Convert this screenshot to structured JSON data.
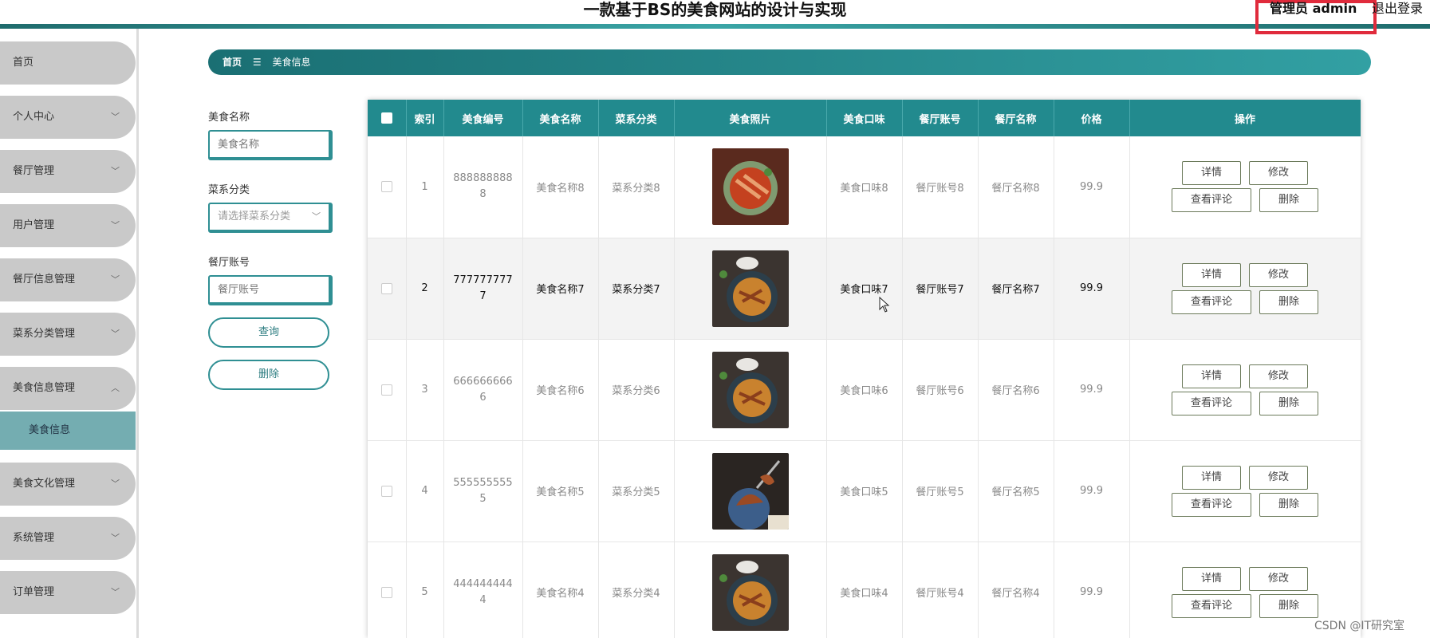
{
  "header": {
    "title": "一款基于BS的美食网站的设计与实现",
    "admin_label": "管理员 admin",
    "logout_label": "退出登录",
    "accent": "#e02b3c"
  },
  "sidebar": {
    "items": [
      {
        "label": "首页"
      },
      {
        "label": "个人中心"
      },
      {
        "label": "餐厅管理"
      },
      {
        "label": "用户管理"
      },
      {
        "label": "餐厅信息管理"
      },
      {
        "label": "菜系分类管理"
      },
      {
        "label": "美食信息管理"
      },
      {
        "label": "美食文化管理"
      },
      {
        "label": "系统管理"
      },
      {
        "label": "订单管理"
      }
    ],
    "sub_item": "美食信息"
  },
  "breadcrumb": {
    "home": "首页",
    "separator": "☰",
    "current": "美食信息"
  },
  "filters": {
    "name_label": "美食名称",
    "name_placeholder": "美食名称",
    "category_label": "菜系分类",
    "category_placeholder": "请选择菜系分类",
    "account_label": "餐厅账号",
    "account_placeholder": "餐厅账号",
    "query_button": "查询",
    "delete_button": "删除"
  },
  "table": {
    "headers": [
      "索引",
      "美食编号",
      "美食名称",
      "菜系分类",
      "美食照片",
      "美食口味",
      "餐厅账号",
      "餐厅名称",
      "价格",
      "操作"
    ],
    "rows": [
      {
        "index": "1",
        "code": "8888888888",
        "name": "美食名称8",
        "category": "菜系分类8",
        "taste": "美食口味8",
        "account": "餐厅账号8",
        "restaurant": "餐厅名称8",
        "price": "99.9"
      },
      {
        "index": "2",
        "code": "7777777777",
        "name": "美食名称7",
        "category": "菜系分类7",
        "taste": "美食口味7",
        "account": "餐厅账号7",
        "restaurant": "餐厅名称7",
        "price": "99.9"
      },
      {
        "index": "3",
        "code": "6666666666",
        "name": "美食名称6",
        "category": "菜系分类6",
        "taste": "美食口味6",
        "account": "餐厅账号6",
        "restaurant": "餐厅名称6",
        "price": "99.9"
      },
      {
        "index": "4",
        "code": "5555555555",
        "name": "美食名称5",
        "category": "菜系分类5",
        "taste": "美食口味5",
        "account": "餐厅账号5",
        "restaurant": "餐厅名称5",
        "price": "99.9"
      },
      {
        "index": "5",
        "code": "4444444444",
        "name": "美食名称4",
        "category": "菜系分类4",
        "taste": "美食口味4",
        "account": "餐厅账号4",
        "restaurant": "餐厅名称4",
        "price": "99.9"
      }
    ],
    "actions": {
      "detail": "详情",
      "edit": "修改",
      "comments": "查看评论",
      "delete": "删除"
    }
  },
  "watermark": "CSDN @IT研究室"
}
